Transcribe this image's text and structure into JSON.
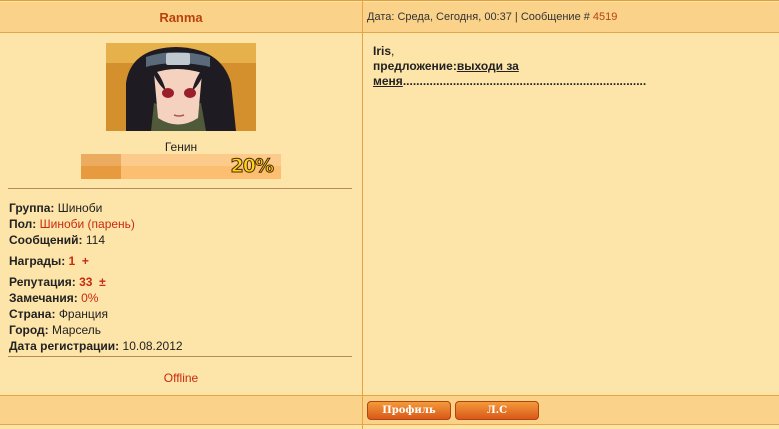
{
  "post": {
    "author": "Ranma",
    "date_label": "Дата: Среда, Сегодня, 00:37 | Сообщение #",
    "message_number": "4519",
    "rank": "Генин",
    "rank_progress_text": "20%",
    "rank_progress": 0.2,
    "profile": {
      "group_label": "Группа:",
      "group_value": "Шиноби",
      "gender_label": "Пол:",
      "gender_value": "Шиноби (парень)",
      "posts_label": "Сообщений:",
      "posts_value": "114",
      "awards_label": "Награды:",
      "awards_value": "1",
      "awards_plus": "+",
      "rep_label": "Репутация:",
      "rep_value": "33",
      "rep_pm": "±",
      "warn_label": "Замечания:",
      "warn_value": "0%",
      "country_label": "Страна:",
      "country_value": "Франция",
      "city_label": "Город:",
      "city_value": "Марсель",
      "reg_label": "Дата регистрации:",
      "reg_value": "10.08.2012"
    },
    "status": "Offline",
    "body": {
      "line1_name": "Iris",
      "line1_comma": ",",
      "line2_prefix": "предложение:",
      "line2_link": "выходи за меня",
      "line2_dots": "........................................................................."
    },
    "buttons": {
      "profile": "Профиль",
      "pm": "Л.С"
    }
  }
}
